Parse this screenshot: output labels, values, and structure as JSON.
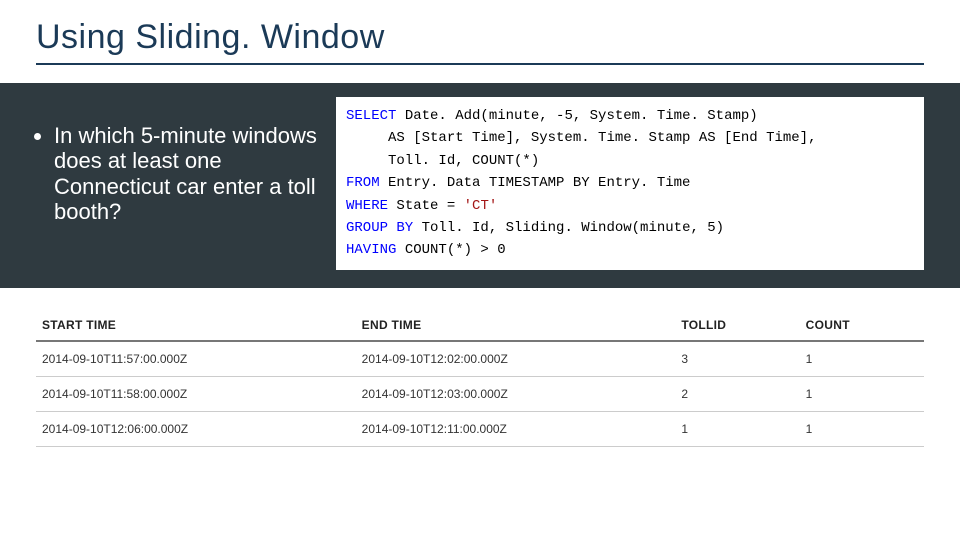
{
  "title": "Using Sliding. Window",
  "bullet": "In which 5-minute windows does at least one Connecticut car enter a toll booth?",
  "code": {
    "l1a": "SELECT",
    "l1b": " Date. Add(minute, -5, System. Time. Stamp)",
    "l2": "     AS [Start Time], System. Time. Stamp AS [End Time],",
    "l3": "     Toll. Id, COUNT(*)",
    "l4a": "FROM",
    "l4b": " Entry. Data TIMESTAMP BY Entry. Time",
    "l5a": "WHERE",
    "l5b": " State = ",
    "l5c": "'CT'",
    "l6a": "GROUP BY",
    "l6b": " Toll. Id, Sliding. Window(minute, 5)",
    "l7a": "HAVING",
    "l7b": " COUNT(*) > 0"
  },
  "table": {
    "headers": {
      "start": "START TIME",
      "end": "END TIME",
      "toll": "TOLLID",
      "count": "COUNT"
    },
    "rows": [
      {
        "start": "2014-09-10T11:57:00.000Z",
        "end": "2014-09-10T12:02:00.000Z",
        "toll": "3",
        "count": "1"
      },
      {
        "start": "2014-09-10T11:58:00.000Z",
        "end": "2014-09-10T12:03:00.000Z",
        "toll": "2",
        "count": "1"
      },
      {
        "start": "2014-09-10T12:06:00.000Z",
        "end": "2014-09-10T12:11:00.000Z",
        "toll": "1",
        "count": "1"
      }
    ]
  }
}
